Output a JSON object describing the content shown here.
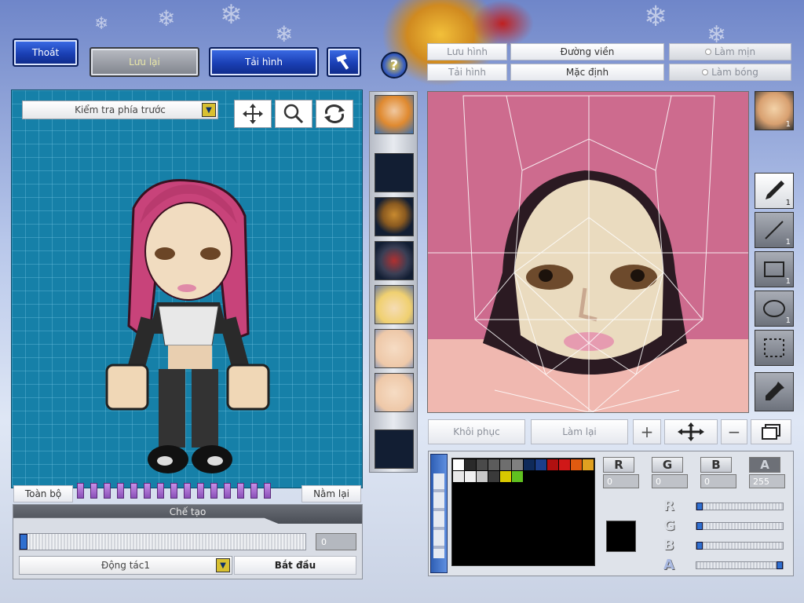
{
  "top_buttons": {
    "thoat": "Thoát",
    "luu_lai": "Lưu lại",
    "tai_hinh": "Tải hình"
  },
  "left_panel": {
    "view_select": "Kiểm tra phía trước",
    "toan_bo": "Toàn bộ",
    "nam_lai": "Nằm lại",
    "che_tao": "Chế tạo",
    "progress_value": "0",
    "action_select": "Động tác1",
    "bat_dau": "Bắt đầu"
  },
  "editor_toolbar": {
    "luu_hinh": "Lưu hình",
    "tai_hinh": "Tải hình",
    "duong_vien": "Đường viền",
    "mac_dinh": "Mặc định",
    "lam_min": "Làm mịn",
    "lam_bong": "Làm bóng",
    "help": "?"
  },
  "editor_bottom": {
    "khoi_phuc": "Khôi phục",
    "lam_lai": "Làm lại"
  },
  "right_tools": {
    "portrait_count": "1",
    "pen_count": "1",
    "line_count": "1",
    "rect_count": "1",
    "ellipse_count": "1"
  },
  "color": {
    "r_label": "R",
    "g_label": "G",
    "b_label": "B",
    "a_label": "A",
    "r_value": "0",
    "g_value": "0",
    "b_value": "0",
    "a_value": "255",
    "r_level": 0,
    "g_level": 0,
    "b_level": 0,
    "a_level": 1,
    "current": "#000000",
    "palette": [
      "#ffffff",
      "#2a2a2a",
      "#4a4a4a",
      "#5c5c5c",
      "#6e6e6e",
      "#808080",
      "#0f2a5a",
      "#1c3e8a",
      "#b01010",
      "#d01818",
      "#e05a10",
      "#e0a020",
      "#e8e8e8",
      "#f0f0f0",
      "#c8c8c8",
      "#3a3a3a",
      "#d8c800",
      "#60c020"
    ]
  }
}
